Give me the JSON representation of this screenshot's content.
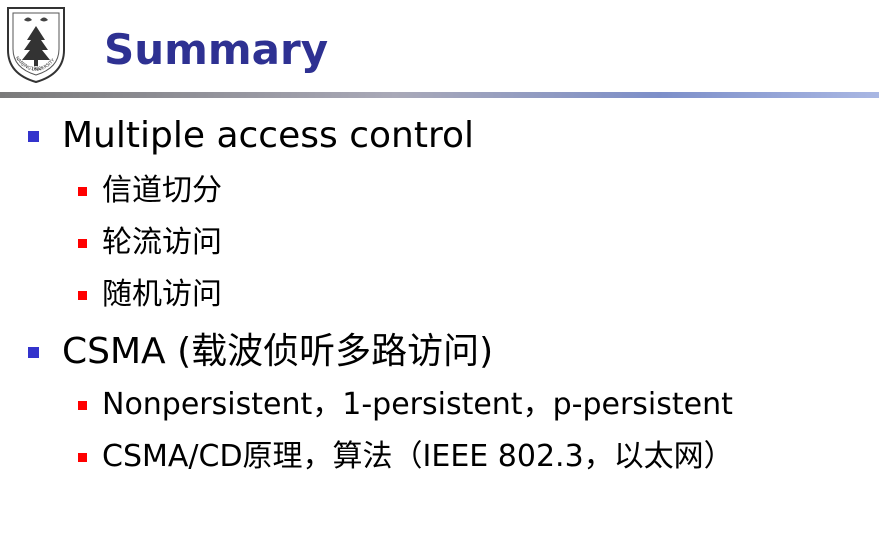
{
  "header": {
    "title": "Summary",
    "logo_icon": "nanjing-university-emblem-icon",
    "logo_text": "NANJING UNIVERSITY 1902"
  },
  "bullets": [
    {
      "level": 1,
      "text": "Multiple access control"
    },
    {
      "level": 2,
      "text": "信道切分"
    },
    {
      "level": 2,
      "text": "轮流访问"
    },
    {
      "level": 2,
      "text": "随机访问"
    },
    {
      "level": 1,
      "text": "CSMA (载波侦听多路访问)"
    },
    {
      "level": 2,
      "text": "Nonpersistent，1-persistent，p-persistent"
    },
    {
      "level": 2,
      "text": "CSMA/CD原理，算法（IEEE 802.3，以太网）"
    }
  ],
  "colors": {
    "title": "#2e3192",
    "level1_marker": "#3333cc",
    "level2_marker": "#ff0000"
  }
}
